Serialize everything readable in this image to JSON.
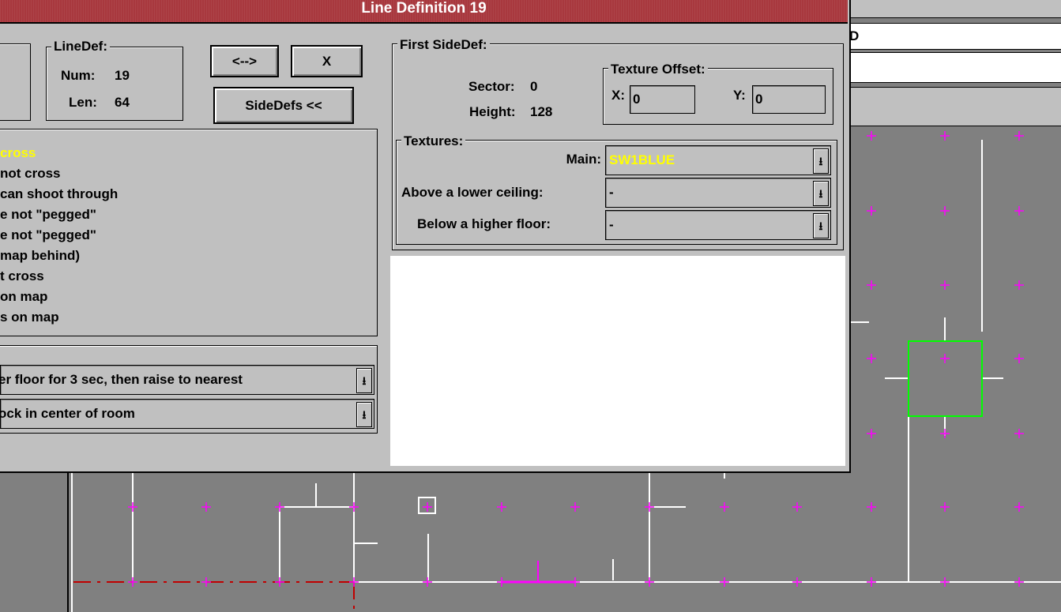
{
  "window": {
    "title": "Line Definition 19"
  },
  "linedef": {
    "group_label": "LineDef:",
    "num_label": "Num:",
    "num": "19",
    "len_label": "Len:",
    "len": "64"
  },
  "buttons": {
    "flip": "<-->",
    "close": "X",
    "sidedefs": "SideDefs <<"
  },
  "flags": [
    "cross",
    "not cross",
    "can shoot through",
    "e not \"pegged\"",
    "e not \"pegged\"",
    " map behind)",
    "t cross",
    " on map",
    "s on map"
  ],
  "selected_flag_index": 0,
  "specials": {
    "type_value": "er floor for 3 sec, then raise to nearest",
    "tag_value": "ock in center of room"
  },
  "first_sidedef": {
    "group_label": "First SideDef:",
    "sector_label": "Sector:",
    "sector": "0",
    "height_label": "Height:",
    "height": "128",
    "offset": {
      "group_label": "Texture Offset:",
      "x_label": "X:",
      "x_value": "0",
      "y_label": "Y:",
      "y_value": "0"
    },
    "textures": {
      "group_label": "Textures:",
      "main_label": "Main:",
      "main_value": "SW1BLUE",
      "above_label": "Above a lower ceiling:",
      "above_value": "-",
      "below_label": "Below a higher floor:",
      "below_value": "-"
    }
  },
  "background": {
    "field_text": "D"
  },
  "colors": {
    "title_bar": "#a8383e",
    "dialog_bg": "#c0c0c0",
    "map_bg": "#808080",
    "grid_plus": "#ff00ff",
    "highlight_text": "#ffff00",
    "selection": "#00ff00",
    "line": "#ffffff",
    "red_line": "#c00000"
  },
  "icons": {
    "dropdown": "dropdown-arrow-icon"
  }
}
